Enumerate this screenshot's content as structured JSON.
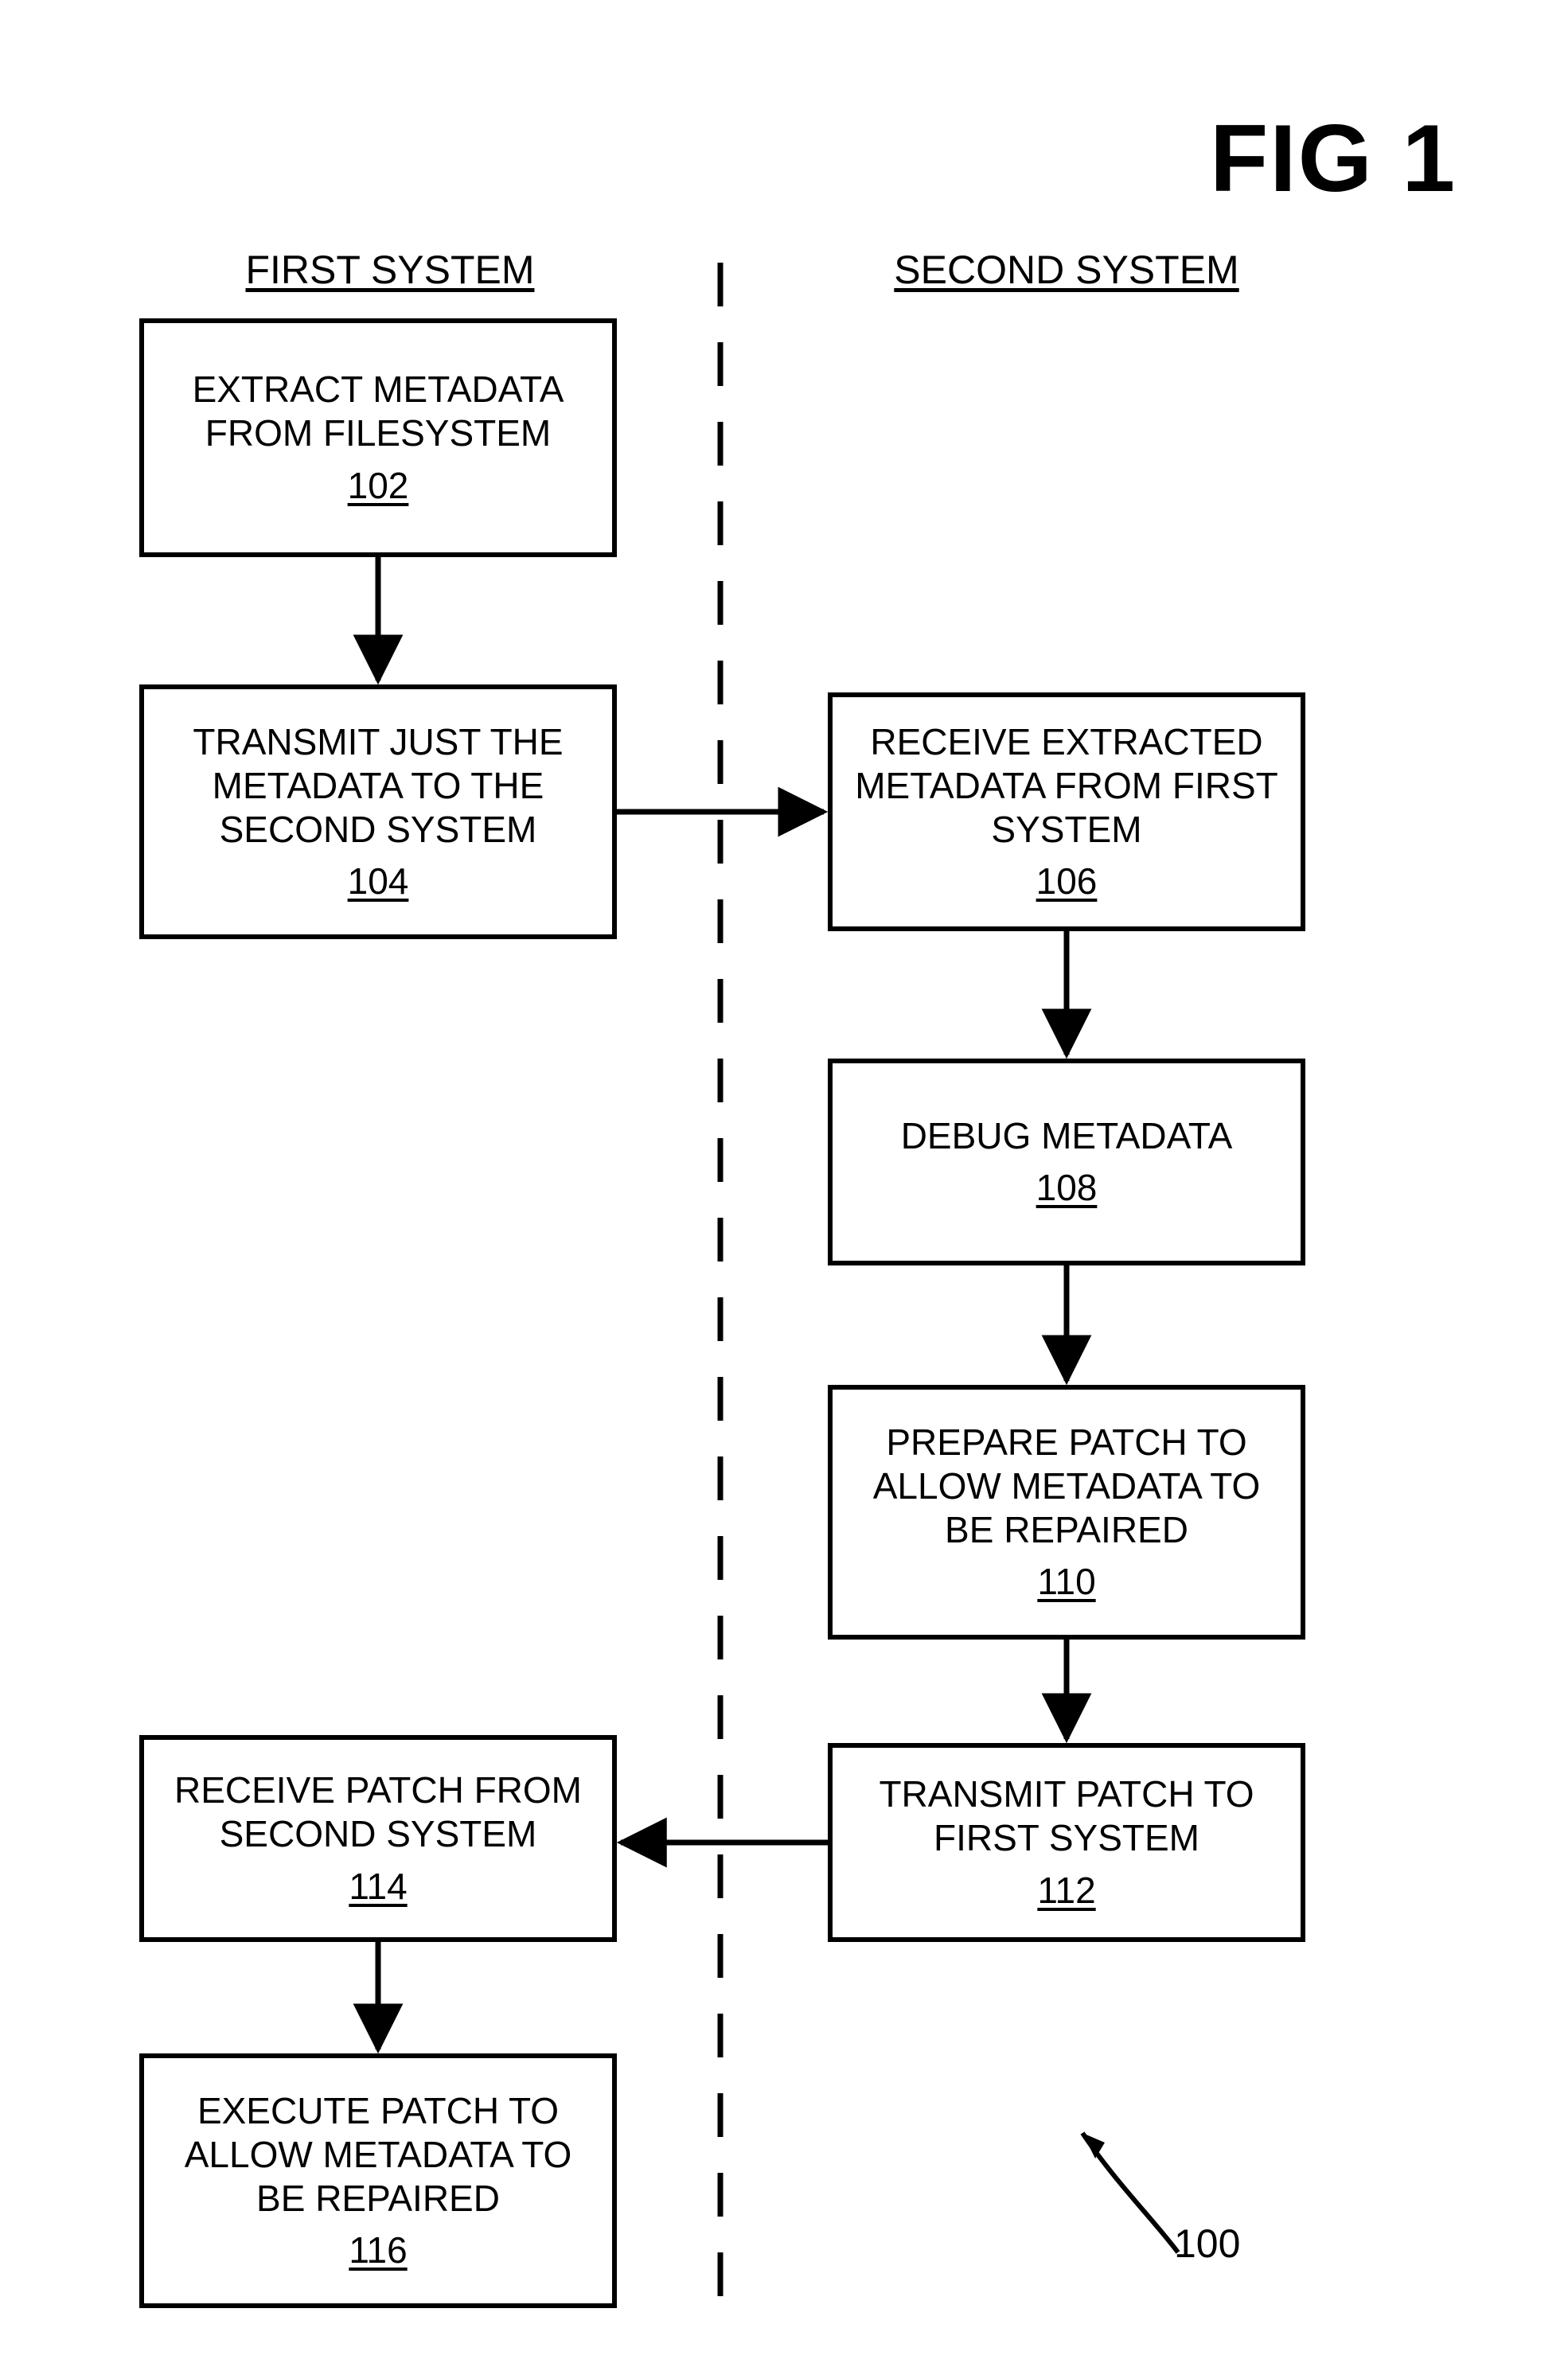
{
  "figure": {
    "title": "FIG 1",
    "ref_number": "100"
  },
  "columns": {
    "left": "FIRST SYSTEM",
    "right": "SECOND SYSTEM"
  },
  "boxes": {
    "b102": {
      "text": "EXTRACT METADATA FROM FILESYSTEM",
      "ref": "102"
    },
    "b104": {
      "text": "TRANSMIT JUST THE METADATA TO THE SECOND SYSTEM",
      "ref": "104"
    },
    "b106": {
      "text": "RECEIVE EXTRACTED METADATA FROM FIRST SYSTEM",
      "ref": "106"
    },
    "b108": {
      "text": "DEBUG METADATA",
      "ref": "108"
    },
    "b110": {
      "text": "PREPARE PATCH TO ALLOW METADATA TO BE REPAIRED",
      "ref": "110"
    },
    "b112": {
      "text": "TRANSMIT PATCH TO FIRST SYSTEM",
      "ref": "112"
    },
    "b114": {
      "text": "RECEIVE PATCH FROM SECOND SYSTEM",
      "ref": "114"
    },
    "b116": {
      "text": "EXECUTE PATCH TO ALLOW METADATA TO BE REPAIRED",
      "ref": "116"
    }
  }
}
